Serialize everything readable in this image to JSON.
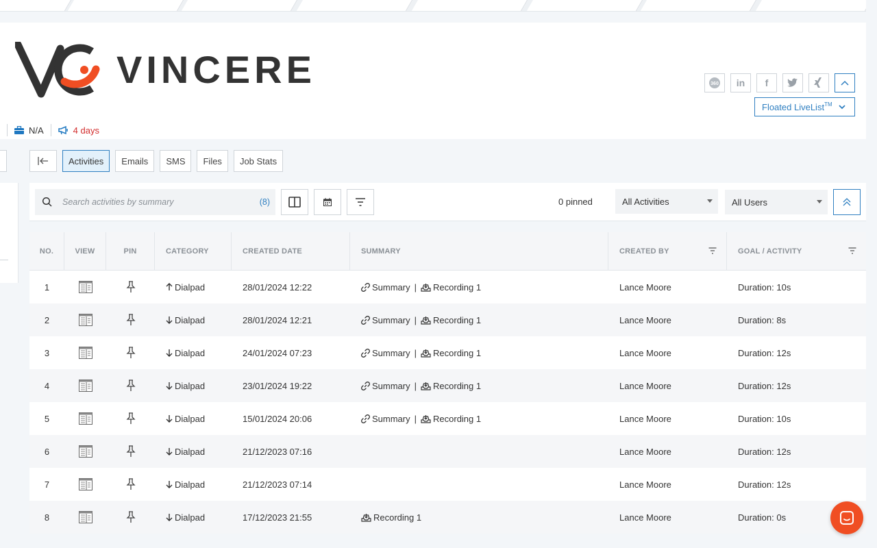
{
  "brand": {
    "name": "VINCERE",
    "accent": "#f04e23",
    "dark": "#333333"
  },
  "header": {
    "social_icons": [
      "360-icon",
      "linkedin-icon",
      "facebook-icon",
      "twitter-icon",
      "xing-icon",
      "chevron-up-icon"
    ],
    "livelist_label": "Floated LiveList",
    "livelist_sup": "TM",
    "meta": {
      "company": "N/A",
      "days": "4 days"
    }
  },
  "tabs": [
    "Activities",
    "Emails",
    "SMS",
    "Files",
    "Job Stats"
  ],
  "active_tab": "Activities",
  "toolbar": {
    "search_placeholder": "Search activities by summary",
    "search_count": "(8)",
    "pinned": "0 pinned",
    "activity_filter": "All Activities",
    "user_filter": "All Users"
  },
  "table": {
    "columns": [
      "NO.",
      "VIEW",
      "PIN",
      "CATEGORY",
      "CREATED DATE",
      "SUMMARY",
      "CREATED BY",
      "GOAL / ACTIVITY"
    ],
    "rows": [
      {
        "no": "1",
        "direction": "up",
        "category": "Dialpad",
        "date": "28/01/2024 12:22",
        "summary": "Summary",
        "recording": "Recording 1",
        "by": "Lance Moore",
        "goal": "Duration: 10s"
      },
      {
        "no": "2",
        "direction": "down",
        "category": "Dialpad",
        "date": "28/01/2024 12:21",
        "summary": "Summary",
        "recording": "Recording 1",
        "by": "Lance Moore",
        "goal": "Duration: 8s"
      },
      {
        "no": "3",
        "direction": "down",
        "category": "Dialpad",
        "date": "24/01/2024 07:23",
        "summary": "Summary",
        "recording": "Recording 1",
        "by": "Lance Moore",
        "goal": "Duration: 12s"
      },
      {
        "no": "4",
        "direction": "down",
        "category": "Dialpad",
        "date": "23/01/2024 19:22",
        "summary": "Summary",
        "recording": "Recording 1",
        "by": "Lance Moore",
        "goal": "Duration: 12s"
      },
      {
        "no": "5",
        "direction": "down",
        "category": "Dialpad",
        "date": "15/01/2024 20:06",
        "summary": "Summary",
        "recording": "Recording 1",
        "by": "Lance Moore",
        "goal": "Duration: 10s"
      },
      {
        "no": "6",
        "direction": "down",
        "category": "Dialpad",
        "date": "21/12/2023 07:16",
        "summary": "",
        "recording": "",
        "by": "Lance Moore",
        "goal": "Duration: 12s"
      },
      {
        "no": "7",
        "direction": "down",
        "category": "Dialpad",
        "date": "21/12/2023 07:14",
        "summary": "",
        "recording": "",
        "by": "Lance Moore",
        "goal": "Duration: 12s"
      },
      {
        "no": "8",
        "direction": "down",
        "category": "Dialpad",
        "date": "17/12/2023 21:55",
        "summary": "",
        "recording": "Recording 1",
        "by": "Lance Moore",
        "goal": "Duration: 0s"
      }
    ]
  }
}
